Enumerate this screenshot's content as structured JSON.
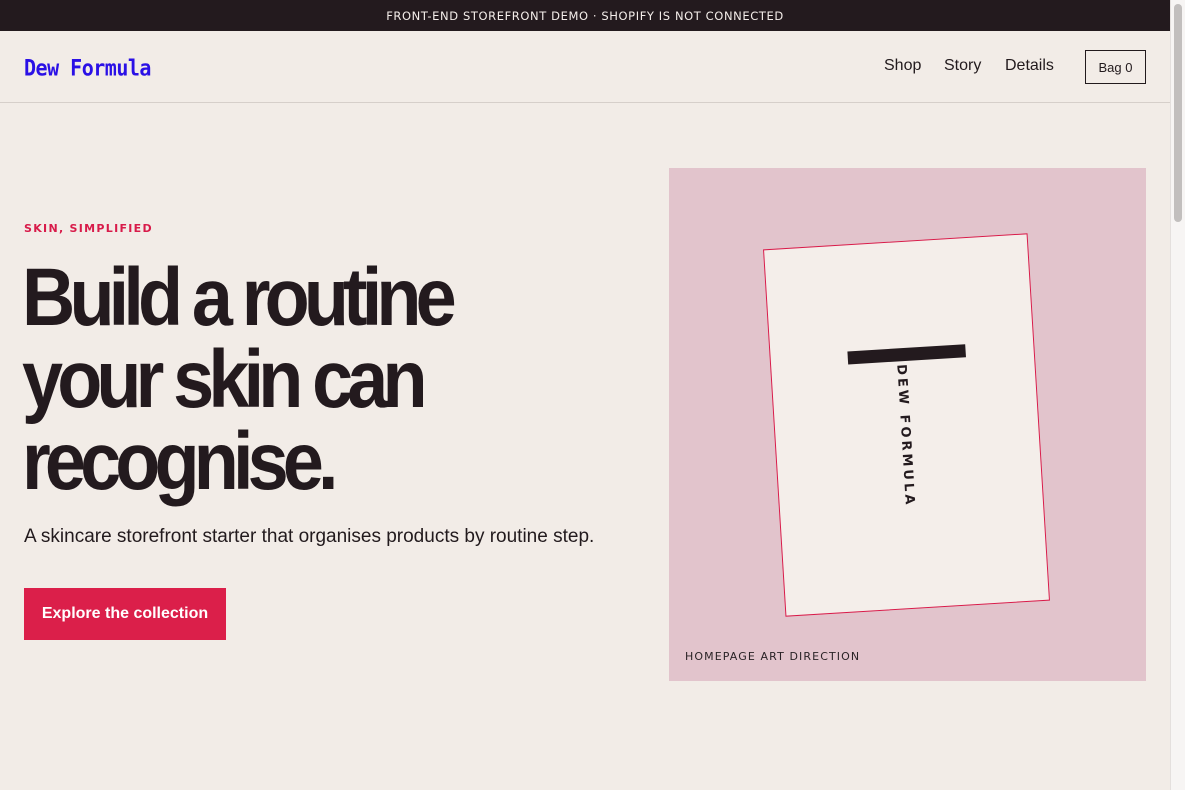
{
  "announcement": "FRONT-END STOREFRONT DEMO · SHOPIFY IS NOT CONNECTED",
  "header": {
    "logo": "Dew Formula",
    "nav": [
      {
        "label": "Shop"
      },
      {
        "label": "Story"
      },
      {
        "label": "Details"
      }
    ],
    "bag_label": "Bag 0"
  },
  "hero": {
    "kicker": "SKIN, SIMPLIFIED",
    "headline_lines": [
      "Build a routine",
      "your skin can",
      "recognise."
    ],
    "subcopy": "A skincare storefront starter that organises products by routine step.",
    "cta_label": "Explore the collection"
  },
  "art": {
    "wordmark": "DEW FORMULA",
    "caption": "HOMEPAGE ART DIRECTION"
  },
  "colors": {
    "background": "#f2ece7",
    "announcement_bg": "#231a1e",
    "logo": "#2a10e6",
    "accent": "#db1f4a",
    "art_panel": "#e2c4cc",
    "ink": "#231a1e"
  }
}
